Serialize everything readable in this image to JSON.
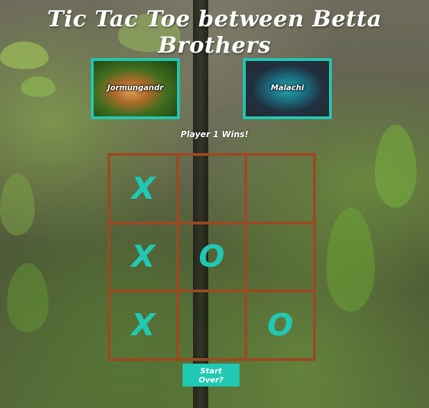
{
  "title": "Tic Tac Toe between Betta Brothers",
  "players": [
    {
      "name": "Jormungandr"
    },
    {
      "name": "Malachi"
    }
  ],
  "status": "Player 1 Wins!",
  "board": [
    [
      "X",
      "",
      ""
    ],
    [
      "X",
      "O",
      ""
    ],
    [
      "X",
      "",
      "O"
    ]
  ],
  "start_over_label": "Start Over?",
  "colors": {
    "accent": "#1fc9b4",
    "grid": "#9a4a22",
    "text": "#ffffff"
  }
}
